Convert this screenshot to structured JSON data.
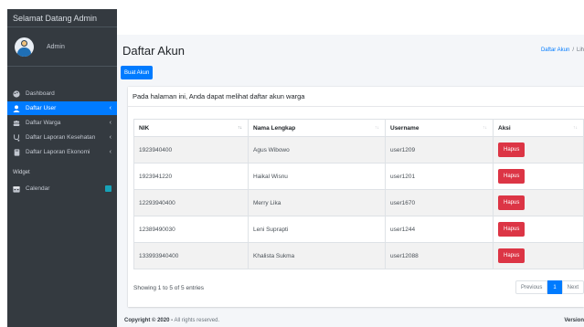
{
  "brand": "Selamat Datang Admin",
  "user": {
    "name": "Admin"
  },
  "nav": {
    "items": [
      {
        "label": "Dashboard",
        "icon": "palette-icon"
      },
      {
        "label": "Daftar User",
        "icon": "user-icon"
      },
      {
        "label": "Daftar Warga",
        "icon": "users-icon"
      },
      {
        "label": "Daftar Laporan Kesehatan",
        "icon": "stethoscope-icon"
      },
      {
        "label": "Daftar Laporan Ekonomi",
        "icon": "book-icon"
      }
    ],
    "header": "Widget",
    "calendar_label": "Calendar"
  },
  "page": {
    "title": "Daftar Akun",
    "breadcrumb_active": "Daftar Akun",
    "breadcrumb_rest": "Lih",
    "create_button": "Buat Akun",
    "description": "Pada halaman ini, Anda dapat melihat daftar akun warga"
  },
  "table": {
    "headers": [
      "NIK",
      "Nama Lengkap",
      "Username",
      "Aksi"
    ],
    "rows": [
      {
        "nik": "1923940400",
        "nama": "Agus Wibowo",
        "username": "user1209",
        "aksi": "Hapus"
      },
      {
        "nik": "1923941220",
        "nama": "Haikal Wisnu",
        "username": "user1201",
        "aksi": "Hapus"
      },
      {
        "nik": "12293940400",
        "nama": "Merry Lika",
        "username": "user1670",
        "aksi": "Hapus"
      },
      {
        "nik": "12389490030",
        "nama": "Leni Suprapti",
        "username": "user1244",
        "aksi": "Hapus"
      },
      {
        "nik": "133993940400",
        "nama": "Khalista Sukma",
        "username": "user12088",
        "aksi": "Hapus"
      }
    ]
  },
  "footer": {
    "info": "Showing 1 to 5 of 5 entries",
    "previous": "Previous",
    "page": "1",
    "next": "Next",
    "copyright": "Copyright © 2020 -",
    "rights": "All rights reserved.",
    "version": "Version"
  },
  "colors": {
    "primary": "#007bff",
    "sidebar": "#343a40",
    "danger": "#dc3545",
    "info_badge": "#17a2b8"
  }
}
